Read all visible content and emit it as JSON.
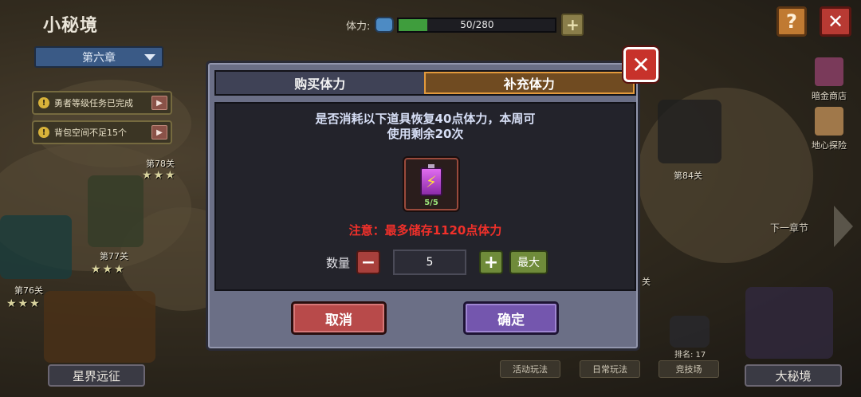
{
  "header": {
    "title": "小秘境",
    "chapter": "第六章",
    "stamina_label": "体力:",
    "stamina_value": "50/280",
    "stamina_fraction": 0.18
  },
  "notices": [
    {
      "text": "勇者等级任务已完成"
    },
    {
      "text": "背包空间不足15个"
    }
  ],
  "levels": {
    "l76": "第76关",
    "l77": "第77关",
    "l78": "第78关",
    "l84": "第84关",
    "partial": "关"
  },
  "side_menu": {
    "shop": "暗金商店",
    "explore": "地心探险",
    "next_chapter": "下一章节"
  },
  "bottom": {
    "star_expedition": "星界远征",
    "activities": "活动玩法",
    "daily": "日常玩法",
    "arena": "竞技场",
    "rank": "排名:  17",
    "big_secret": "大秘境"
  },
  "modal": {
    "tab_buy": "购买体力",
    "tab_refill": "补充体力",
    "message_line1": "是否消耗以下道具恢复40点体力，本周可",
    "message_line2": "使用剩余20次",
    "item_count": "5/5",
    "warning": "注意：最多储存1120点体力",
    "qty_label": "数量",
    "qty_value": "5",
    "max_label": "最大",
    "cancel_label": "取消",
    "confirm_label": "确定"
  },
  "icons": {
    "close": "close-icon",
    "help": "help-icon",
    "minus": "minus-icon",
    "plus": "plus-icon",
    "battery": "battery-icon",
    "chevron": "chevron-down-icon"
  }
}
